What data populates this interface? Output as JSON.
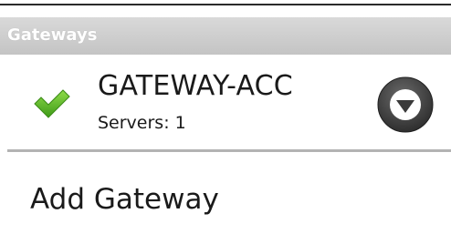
{
  "section": {
    "header_label": "Gateways"
  },
  "gateway": {
    "name": "GATEWAY-ACC",
    "servers_text": "Servers: 1",
    "status_icon": "check-icon",
    "menu_icon": "chevron-down-icon"
  },
  "actions": {
    "add_label": "Add Gateway"
  },
  "colors": {
    "check_green": "#5cb82a",
    "header_bg": "#cfcfcf",
    "button_dark": "#3a3a3a"
  }
}
